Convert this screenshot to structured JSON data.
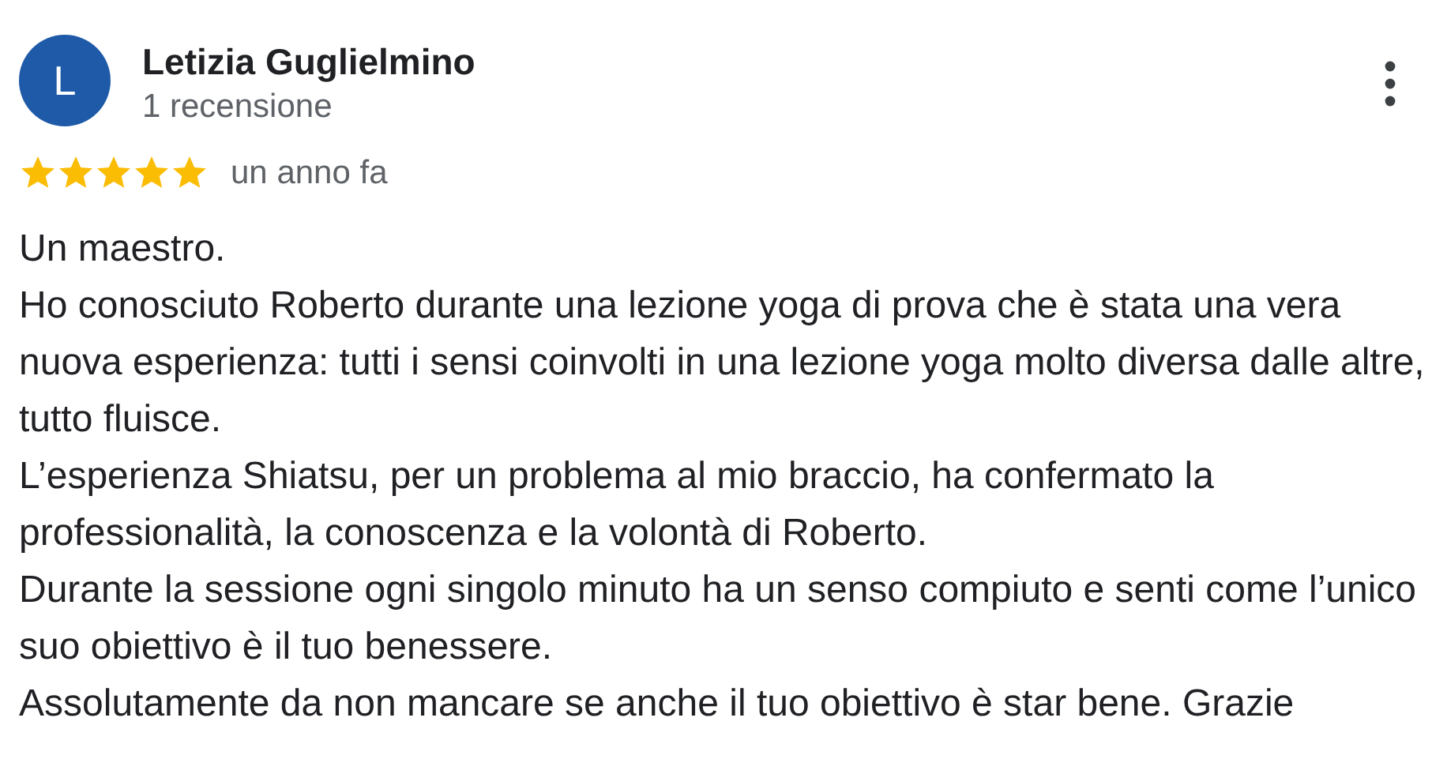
{
  "review": {
    "avatar_letter": "L",
    "author": "Letizia Guglielmino",
    "author_meta": "1 recensione",
    "stars": 5,
    "time": "un anno fa",
    "paragraphs": [
      "Un maestro.",
      "Ho conosciuto Roberto durante una lezione yoga di prova che è stata una vera nuova esperienza: tutti i sensi coinvolti in una lezione yoga molto diversa dalle altre, tutto fluisce.",
      "L’esperienza Shiatsu, per un problema al mio braccio, ha confermato la professionalità, la conoscenza e la volontà di Roberto.",
      "Durante la sessione ogni singolo minuto ha un senso compiuto e senti come l’unico suo obiettivo è il tuo benessere.",
      "Assolutamente da non mancare se anche il tuo obiettivo è star bene. Grazie"
    ]
  }
}
